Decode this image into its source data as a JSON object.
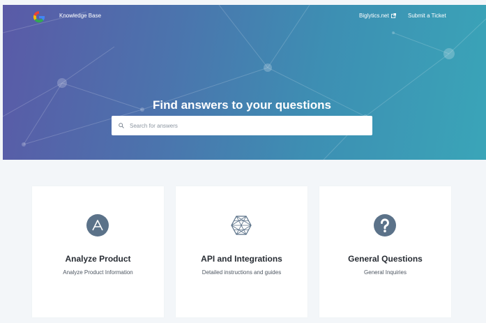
{
  "header": {
    "brand": "Knowledge Base",
    "logo_icon": "google-logo-icon",
    "links": [
      {
        "label": "Biglytics.net",
        "icon": "external-link-icon"
      },
      {
        "label": "Submit a Ticket"
      }
    ]
  },
  "hero": {
    "title": "Find answers to your questions",
    "search_placeholder": "Search for answers",
    "search_value": ""
  },
  "categories": [
    {
      "icon": "letter-a-circle-icon",
      "title": "Analyze Product",
      "description": "Analyze Product Information"
    },
    {
      "icon": "hexagon-mesh-icon",
      "title": "API and Integrations",
      "description": "Detailed instructions and guides"
    },
    {
      "icon": "question-circle-icon",
      "title": "General Questions",
      "description": "General Inquiries"
    }
  ],
  "colors": {
    "hero_start": "#5a5aa7",
    "hero_end": "#3aa5b8",
    "icon_fill": "#5b7289",
    "page_bg": "#f3f6f9"
  }
}
